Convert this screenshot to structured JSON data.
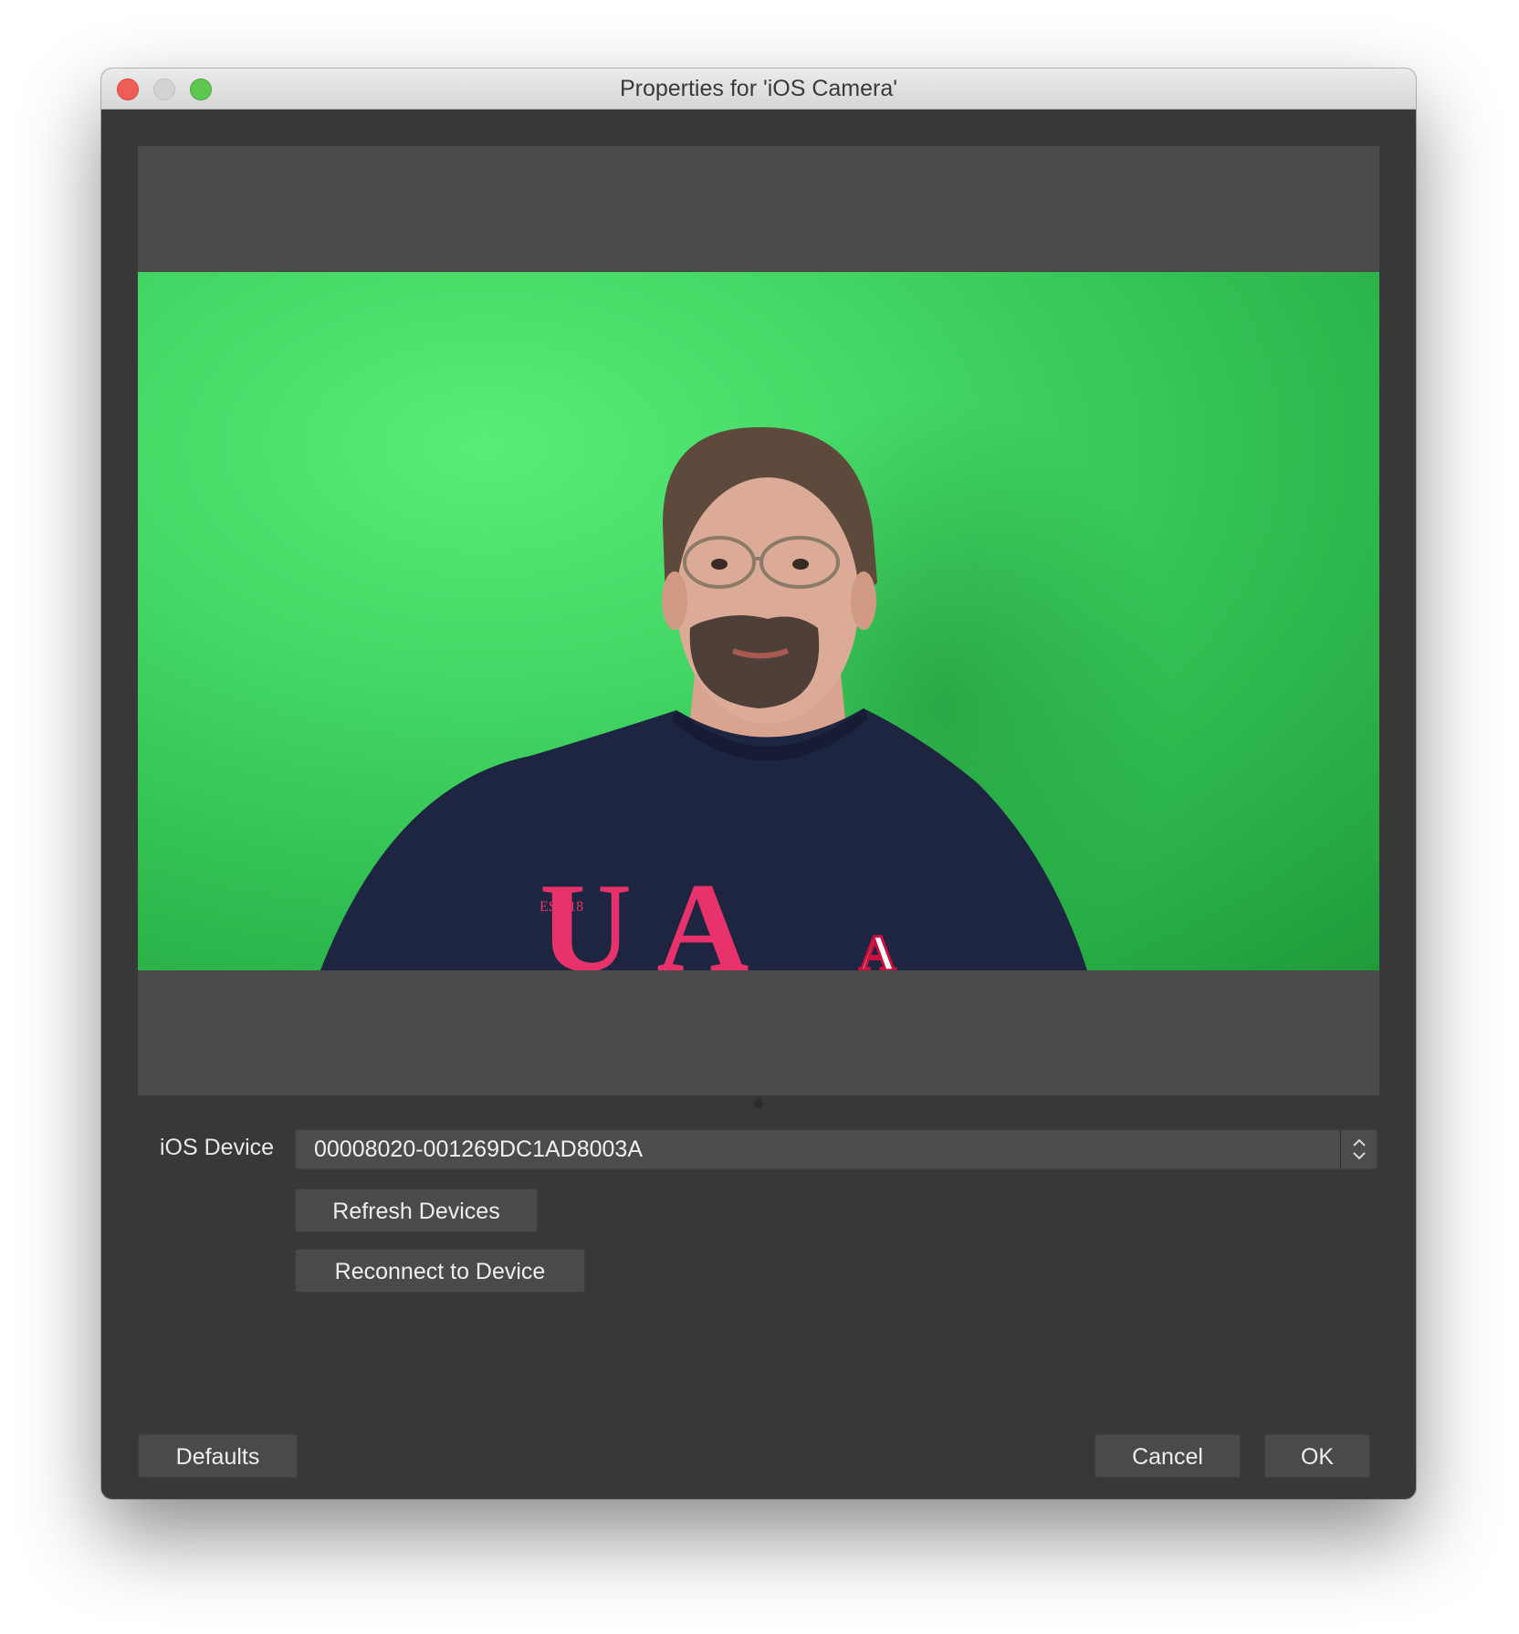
{
  "window": {
    "title": "Properties for 'iOS Camera'"
  },
  "preview": {
    "shirt_text": "U A",
    "shirt_logo": "A",
    "shirt_small_text": "EST 18"
  },
  "form": {
    "device_label": "iOS Device",
    "device_value": "00008020-001269DC1AD8003A",
    "refresh_label": "Refresh Devices",
    "reconnect_label": "Reconnect to Device"
  },
  "footer": {
    "defaults_label": "Defaults",
    "cancel_label": "Cancel",
    "ok_label": "OK"
  },
  "icons": [
    "close-icon",
    "minimize-icon",
    "zoom-icon",
    "select-arrows-icon"
  ]
}
